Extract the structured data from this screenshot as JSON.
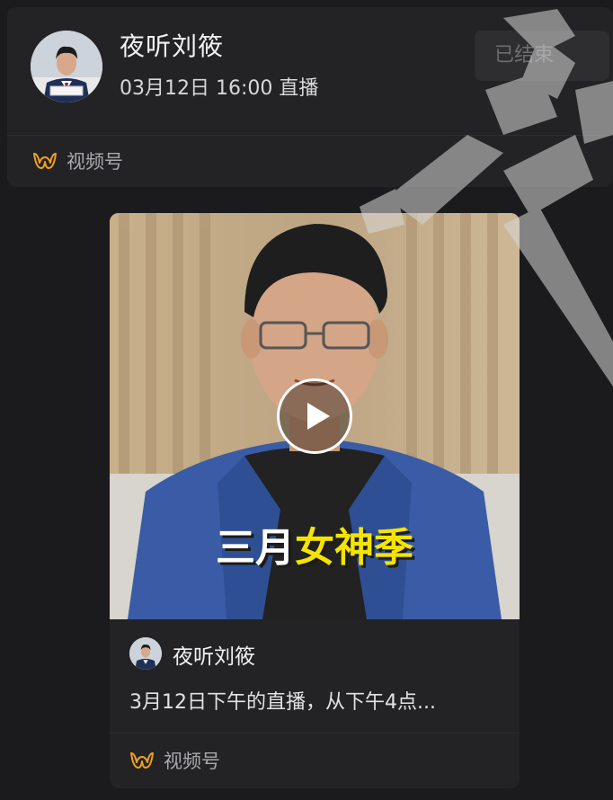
{
  "live": {
    "host_name": "夜听刘筱",
    "time": "03月12日 16:00 直播",
    "status_label": "已结束",
    "channel_label": "视频号"
  },
  "video": {
    "caption_part1": "三月",
    "caption_part2": "女神季",
    "author": "夜听刘筱",
    "description": "3月12日下午的直播，从下午4点...",
    "channel_label": "视频号"
  },
  "icons": {
    "channel": "channels-logo-icon",
    "play": "play-icon"
  },
  "colors": {
    "background": "#1b1b1d",
    "card": "#232325",
    "channel_icon": "#f0a020",
    "caption_highlight": "#f4e400"
  }
}
